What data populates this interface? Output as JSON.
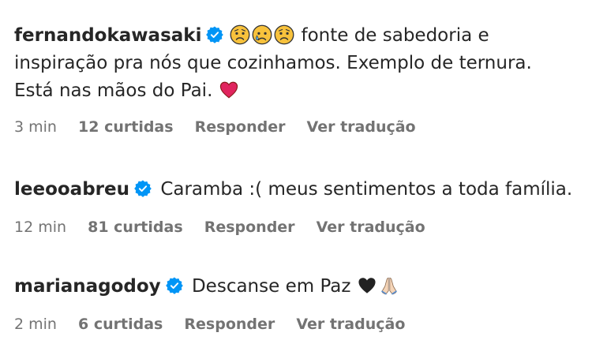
{
  "comments": [
    {
      "username": "fernandokawasaki",
      "verified": true,
      "leading_emojis": [
        "sad-face",
        "crying-face",
        "sad-face"
      ],
      "text": "fonte de sabedoria e inspiração pra nós que cozinhamos. Exemplo de ternura. Está nas mãos do Pai.",
      "trailing_emoji": "red-heart",
      "time": "3 min",
      "likes": "12 curtidas",
      "reply": "Responder",
      "translate": "Ver tradução"
    },
    {
      "username": "leeooabreu",
      "verified": true,
      "text": "Caramba :( meus sentimentos a toda família.",
      "time": "12 min",
      "likes": "81 curtidas",
      "reply": "Responder",
      "translate": "Ver tradução"
    },
    {
      "username": "marianagodoy",
      "verified": true,
      "text": "Descanse em Paz",
      "trailing_emojis": [
        "black-heart",
        "folded-hands"
      ],
      "time": "2 min",
      "likes": "6 curtidas",
      "reply": "Responder",
      "translate": "Ver tradução"
    }
  ],
  "colors": {
    "text": "#262626",
    "secondary": "#737373",
    "verified": "#0095f6"
  }
}
